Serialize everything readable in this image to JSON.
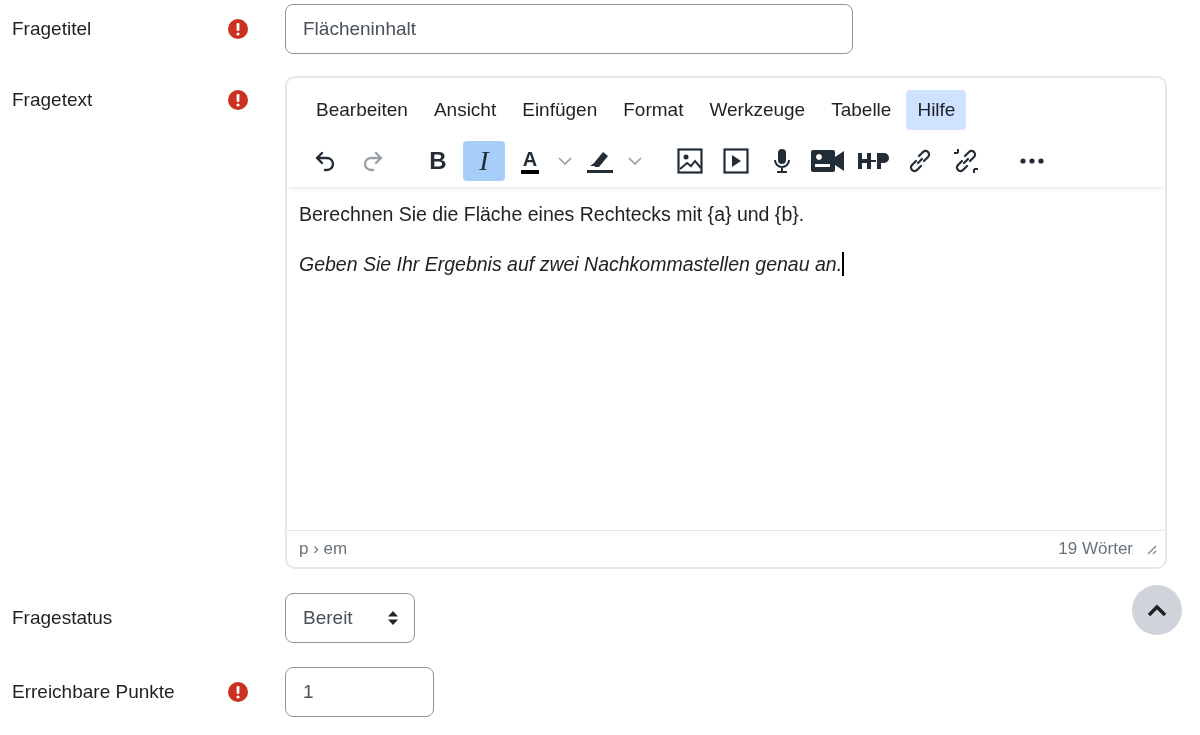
{
  "fields": [
    {
      "kind": "text",
      "label": "Fragetitel",
      "required": true,
      "value": "Flächeninhalt"
    },
    {
      "kind": "editor",
      "label": "Fragetext",
      "required": true
    },
    {
      "kind": "select",
      "label": "Fragestatus",
      "required": false,
      "value": "Bereit"
    },
    {
      "kind": "number",
      "label": "Erreichbare Punkte",
      "required": true,
      "value": "1"
    }
  ],
  "editor": {
    "menu": [
      {
        "label": "Bearbeiten",
        "selected": false
      },
      {
        "label": "Ansicht",
        "selected": false
      },
      {
        "label": "Einfügen",
        "selected": false
      },
      {
        "label": "Format",
        "selected": false
      },
      {
        "label": "Werkzeuge",
        "selected": false
      },
      {
        "label": "Tabelle",
        "selected": false
      },
      {
        "label": "Hilfe",
        "selected": true
      }
    ],
    "toolbar": [
      [
        {
          "kind": "undo",
          "selected": false,
          "disabled": false
        },
        {
          "kind": "redo",
          "selected": false,
          "disabled": true
        }
      ],
      [
        {
          "kind": "bold",
          "label": "B",
          "selected": false,
          "disabled": false
        },
        {
          "kind": "italic",
          "label": "I",
          "selected": true,
          "disabled": false
        },
        {
          "kind": "text-color",
          "label": "A",
          "selected": false,
          "disabled": false
        },
        {
          "kind": "caret",
          "selected": false,
          "disabled": false
        },
        {
          "kind": "highlight",
          "selected": false,
          "disabled": false
        },
        {
          "kind": "caret",
          "selected": false,
          "disabled": false
        }
      ],
      [
        {
          "kind": "image",
          "selected": false,
          "disabled": false
        },
        {
          "kind": "media",
          "selected": false,
          "disabled": false
        },
        {
          "kind": "mic",
          "selected": false,
          "disabled": false
        },
        {
          "kind": "video",
          "selected": false,
          "disabled": false
        },
        {
          "kind": "h5p",
          "selected": false,
          "disabled": false
        },
        {
          "kind": "link",
          "selected": false,
          "disabled": false
        },
        {
          "kind": "unlink",
          "selected": false,
          "disabled": false
        }
      ],
      [
        {
          "kind": "more",
          "selected": false,
          "disabled": false
        }
      ]
    ],
    "paragraphs": [
      {
        "kind": "plain",
        "text": "Berechnen Sie die Fläche eines Rechtecks mit {a} und {b}."
      },
      {
        "kind": "emphasis",
        "text": "Geben Sie Ihr Ergebnis auf zwei Nachkommastellen genau an.",
        "cursor": true
      }
    ],
    "path": "p › em",
    "word_count": "19 Wörter"
  }
}
